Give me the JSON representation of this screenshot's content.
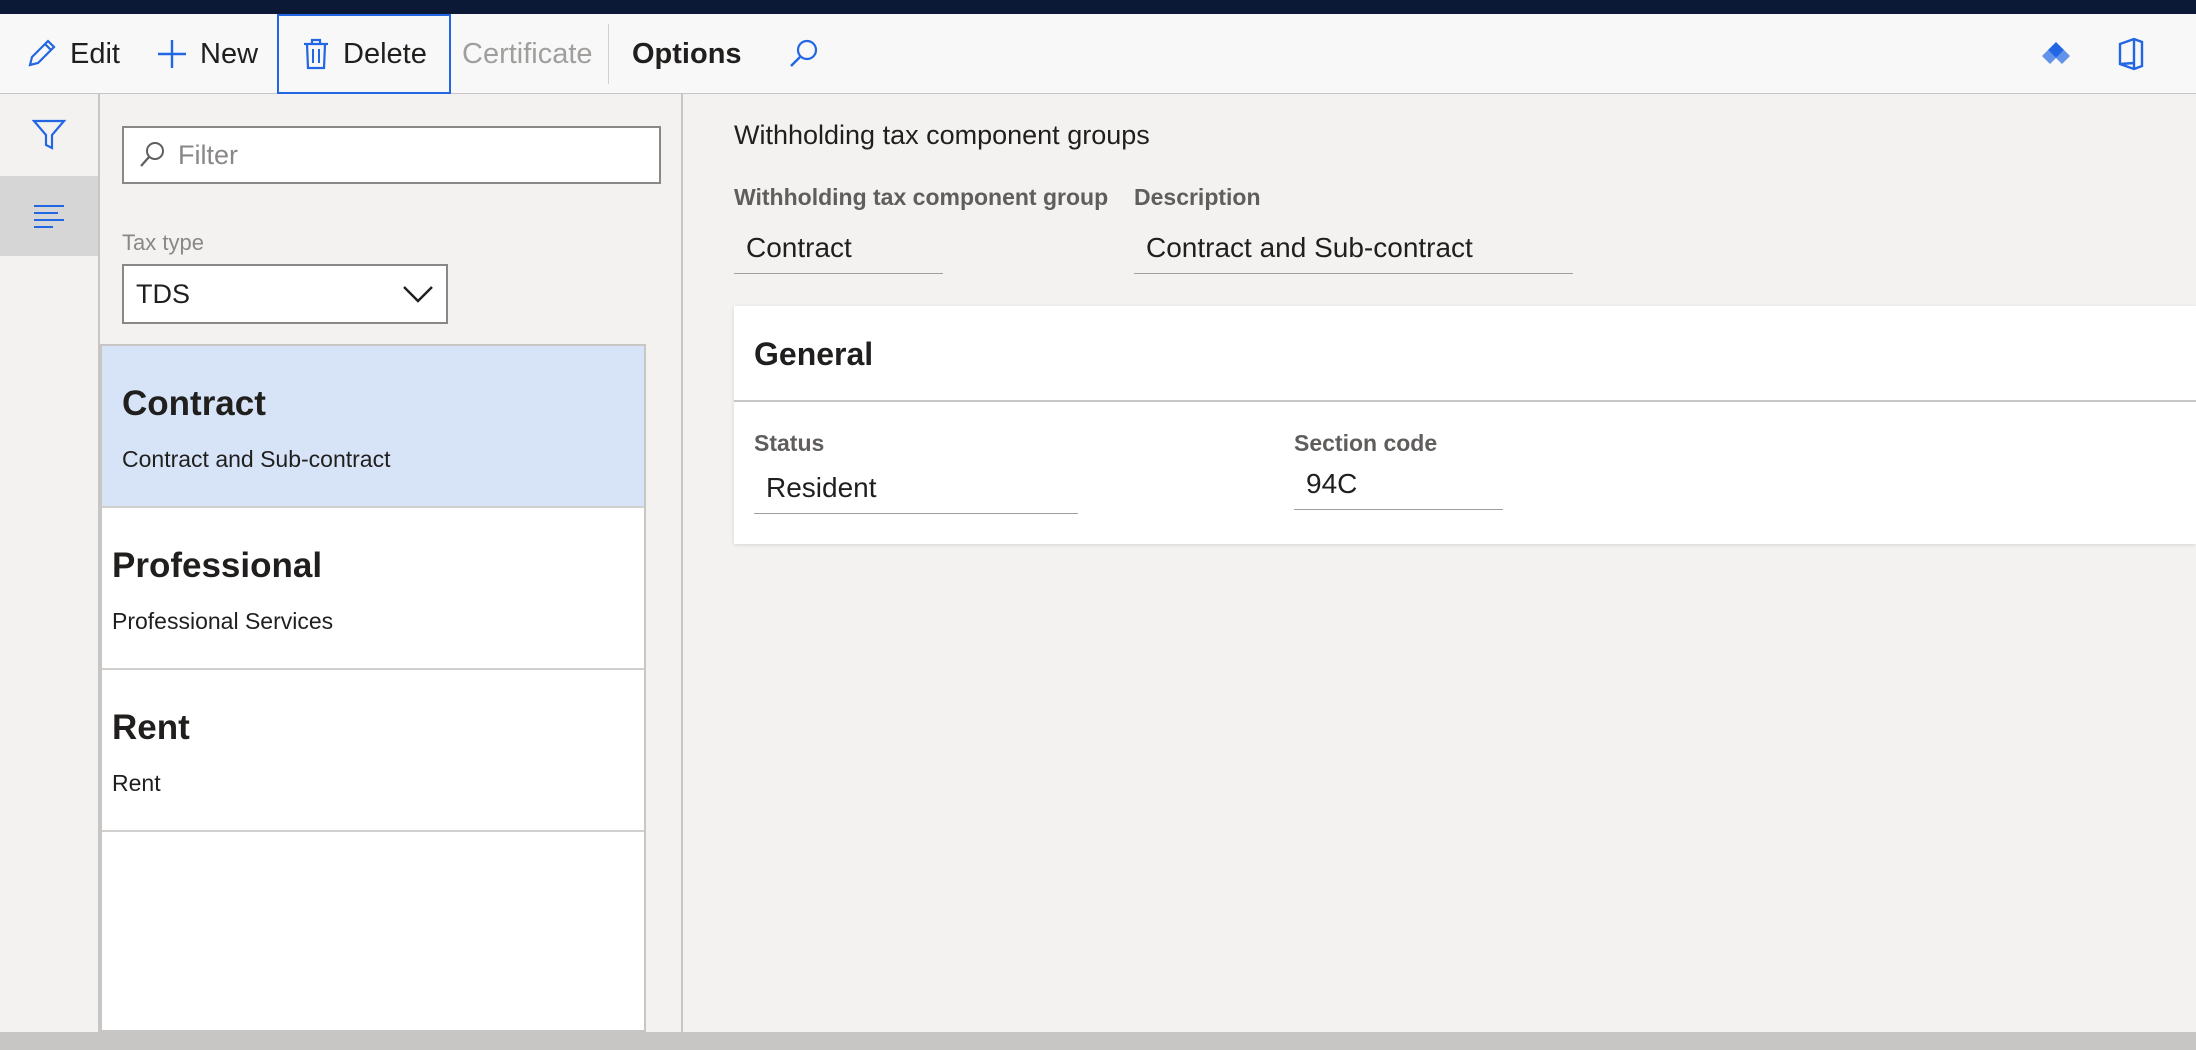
{
  "toolbar": {
    "edit": "Edit",
    "new": "New",
    "delete": "Delete",
    "certificate": "Certificate",
    "options": "Options",
    "icons": [
      "edit-pencil-icon",
      "plus-icon",
      "trash-icon",
      "search-icon",
      "diamond-icon",
      "office-icon"
    ]
  },
  "nav": {
    "icons": [
      "filter-icon",
      "list-lines-icon"
    ]
  },
  "list_panel": {
    "filter_placeholder": "Filter",
    "tax_type_label": "Tax type",
    "tax_type_value": "TDS",
    "items": [
      {
        "title": "Contract",
        "description": "Contract and Sub-contract",
        "selected": true
      },
      {
        "title": "Professional",
        "description": "Professional Services",
        "selected": false
      },
      {
        "title": "Rent",
        "description": "Rent",
        "selected": false
      }
    ]
  },
  "details": {
    "page_title": "Withholding tax component groups",
    "group_label": "Withholding tax component group",
    "group_value": "Contract",
    "description_label": "Description",
    "description_value": "Contract and Sub-contract",
    "general": {
      "header": "General",
      "status_label": "Status",
      "status_value": "Resident",
      "section_code_label": "Section code",
      "section_code_value": "94C"
    }
  },
  "colors": {
    "accent": "#2266e3",
    "selected_row": "#d7e4f8",
    "topbar": "#0b1836"
  }
}
